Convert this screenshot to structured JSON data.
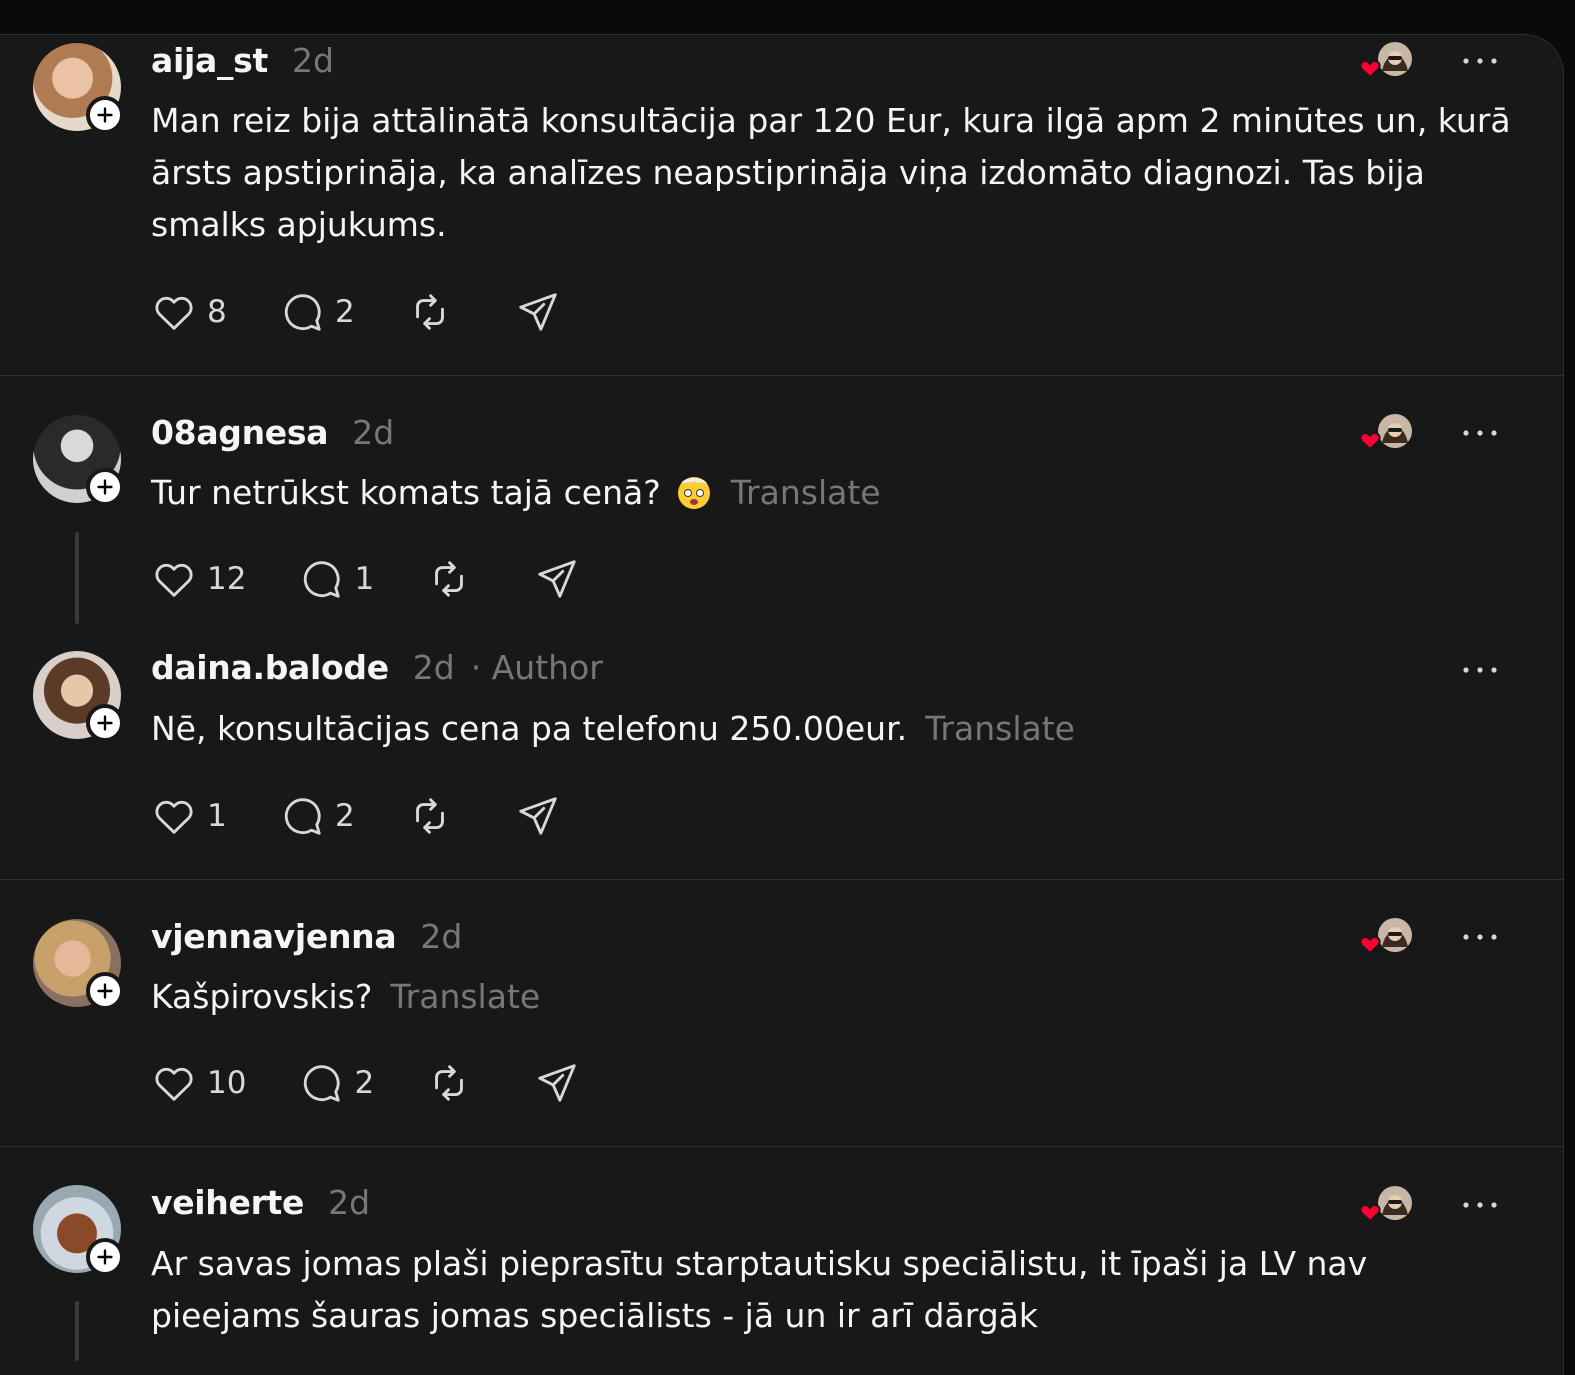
{
  "posts": [
    {
      "username": "aija_st",
      "time": "2d",
      "text": "Man reiz bija attālinātā konsultācija par 120 Eur, kura ilgā apm 2 minūtes un, kurā ārsts apstiprināja, ka analīzes neapstiprināja viņa izdomāto diagnozi. Tas bija smalks apjukums.",
      "likes": "8",
      "replies": "2"
    },
    {
      "username": "08agnesa",
      "time": "2d",
      "text": "Tur netrūkst komats tajā cenā?",
      "translate": "Translate",
      "likes": "12",
      "replies": "1"
    },
    {
      "username": "daina.balode",
      "time": "2d",
      "author_badge": "· Author",
      "text": "Nē, konsultācijas cena pa telefonu 250.00eur.",
      "translate": "Translate",
      "likes": "1",
      "replies": "2"
    },
    {
      "username": "vjennavjenna",
      "time": "2d",
      "text": "Kašpirovskis?",
      "translate": "Translate",
      "likes": "10",
      "replies": "2"
    },
    {
      "username": "veiherte",
      "time": "2d",
      "text": "Ar savas jomas plaši pieprasītu starptautisku speciālistu, it īpaši ja LV nav pieejams šauras jomas speciālists - jā un ir arī dārgāk"
    }
  ],
  "colors": {
    "background": "#181818",
    "text": "#f3f5f7",
    "muted": "#777777",
    "heart": "#ff0033"
  },
  "icons": [
    "heart-icon",
    "comment-icon",
    "repost-icon",
    "share-icon",
    "more-icon",
    "plus-icon",
    "mind-blown-emoji"
  ]
}
